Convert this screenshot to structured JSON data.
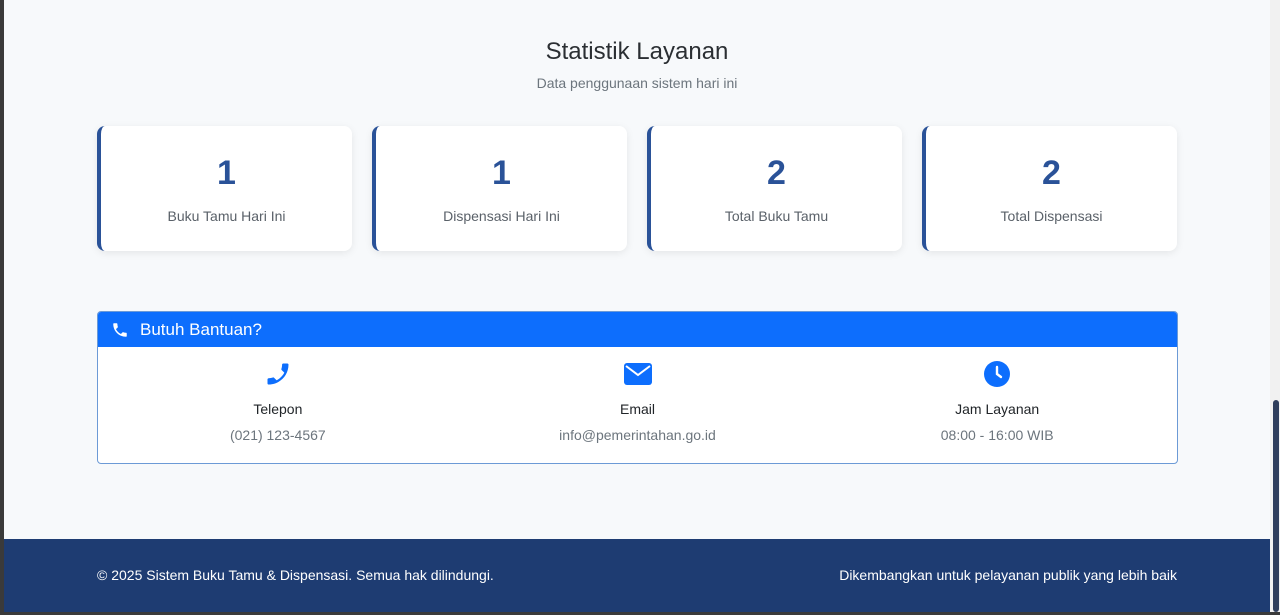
{
  "stats_section": {
    "title": "Statistik Layanan",
    "subtitle": "Data penggunaan sistem hari ini",
    "cards": [
      {
        "value": "1",
        "label": "Buku Tamu Hari Ini"
      },
      {
        "value": "1",
        "label": "Dispensasi Hari Ini"
      },
      {
        "value": "2",
        "label": "Total Buku Tamu"
      },
      {
        "value": "2",
        "label": "Total Dispensasi"
      }
    ]
  },
  "help": {
    "title": "Butuh Bantuan?",
    "header_icon": "phone-icon",
    "items": [
      {
        "icon": "phone-icon",
        "title": "Telepon",
        "value": "(021) 123-4567"
      },
      {
        "icon": "envelope-icon",
        "title": "Email",
        "value": "info@pemerintahan.go.id"
      },
      {
        "icon": "clock-icon",
        "title": "Jam Layanan",
        "value": "08:00 - 16:00 WIB"
      }
    ]
  },
  "footer": {
    "copyright": "© 2025 Sistem Buku Tamu & Dispensasi. Semua hak dilindungi.",
    "tagline": "Dikembangkan untuk pelayanan publik yang lebih baik"
  },
  "colors": {
    "primary": "#0d6efd",
    "stat_accent": "#2a5298",
    "footer_bg": "#1e3c72"
  }
}
